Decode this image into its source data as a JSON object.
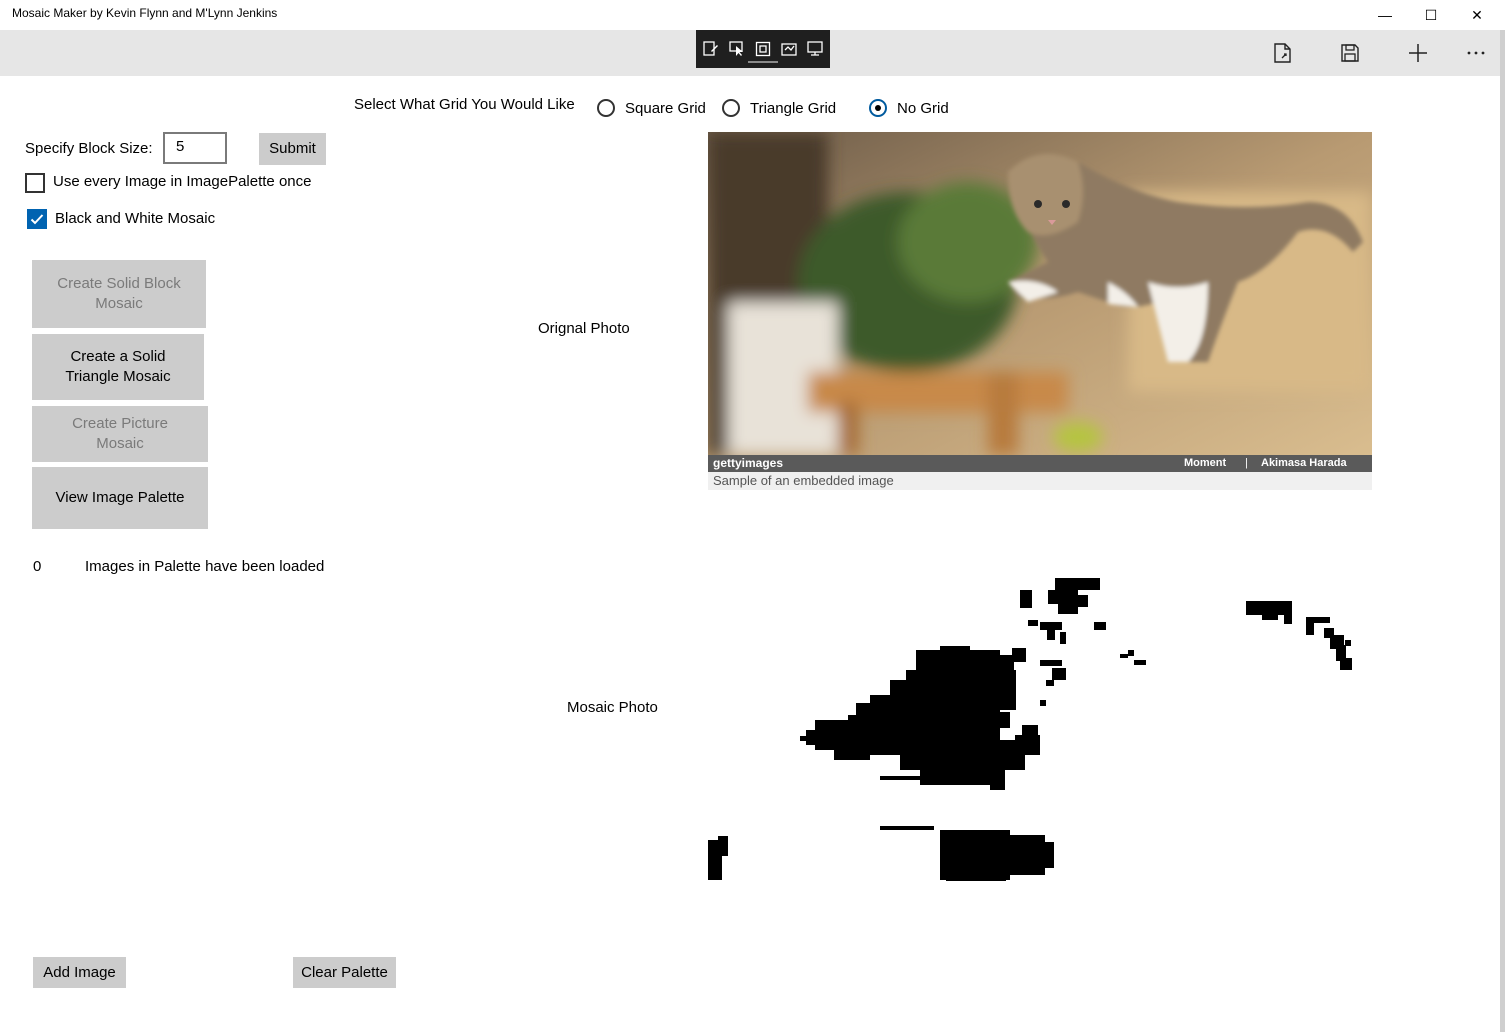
{
  "window": {
    "title": "Mosaic Maker by Kevin Flynn and M'Lynn Jenkins",
    "minimize_glyph": "—",
    "maximize_glyph": "☐",
    "close_glyph": "✕"
  },
  "command_bar": {
    "ink_tools": [
      "ink-tool-icon",
      "select-tool-icon",
      "frame-tool-icon",
      "ruler-tool-icon",
      "screen-tool-icon"
    ],
    "buttons": [
      "open-file-icon",
      "save-icon",
      "add-icon",
      "more-icon"
    ]
  },
  "grid": {
    "prompt": "Select What Grid You Would Like",
    "options": [
      {
        "label": "Square Grid",
        "selected": false
      },
      {
        "label": "Triangle Grid",
        "selected": false
      },
      {
        "label": "No Grid",
        "selected": true
      }
    ]
  },
  "block_size": {
    "label": "Specify Block Size:",
    "value": "5",
    "submit_label": "Submit"
  },
  "options": {
    "use_every_image": {
      "label": "Use every Image in ImagePalette once",
      "checked": false
    },
    "black_white": {
      "label": "Black and White Mosaic",
      "checked": true
    }
  },
  "actions": {
    "solid_block": {
      "label": "Create Solid Block Mosaic",
      "enabled": false
    },
    "solid_triangle": {
      "label": "Create a Solid Triangle Mosaic",
      "enabled": true
    },
    "picture_mosaic": {
      "label": "Create Picture Mosaic",
      "enabled": false
    },
    "view_palette": {
      "label": "View Image Palette",
      "enabled": true
    }
  },
  "palette_status": {
    "count": "0",
    "text": "Images in Palette have been loaded"
  },
  "original": {
    "label": "Orignal Photo",
    "brand": "gettyimages",
    "credit_left": "Moment",
    "credit_sep": "|",
    "credit_right": "Akimasa Harada",
    "caption": "Sample of an embedded image"
  },
  "mosaic": {
    "label": "Mosaic Photo"
  },
  "bottom": {
    "add_image": "Add Image",
    "clear_palette": "Clear Palette"
  },
  "colors": {
    "accent": "#0063b1",
    "button_bg": "#cccccc",
    "command_bar_bg": "#e6e6e6"
  }
}
